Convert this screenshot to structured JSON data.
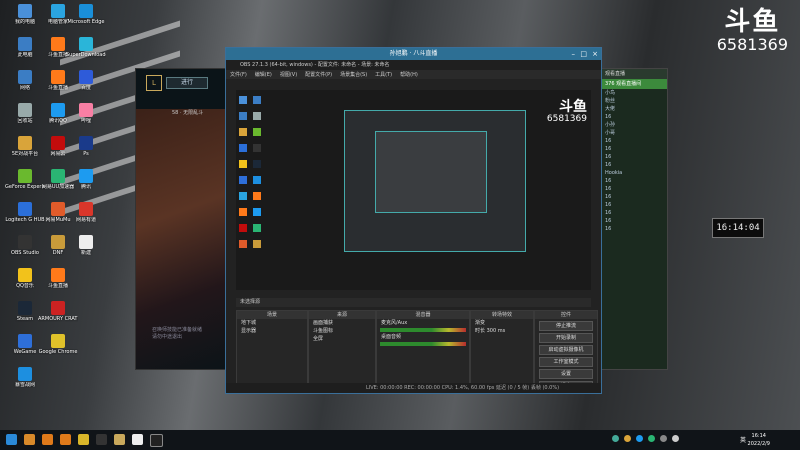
{
  "desktop_icons": [
    {
      "label": "我的电脑",
      "icon": "computer-icon",
      "color": "#4a90d9"
    },
    {
      "label": "此电脑",
      "icon": "computer-icon",
      "color": "#3b7dc4"
    },
    {
      "label": "网络",
      "icon": "network-icon",
      "color": "#3b7dc4"
    },
    {
      "label": "回收站",
      "icon": "recycle-bin-icon",
      "color": "#9aa"
    },
    {
      "label": "5E对战平台",
      "icon": "game-icon",
      "color": "#d9a43a"
    },
    {
      "label": "GeForce Experience",
      "icon": "nvidia-icon",
      "color": "#6ab92e"
    },
    {
      "label": "Logitech G HUB",
      "icon": "logitech-icon",
      "color": "#2b6fd9"
    },
    {
      "label": "OBS Studio",
      "icon": "obs-icon",
      "color": "#333"
    },
    {
      "label": "QQ音乐",
      "icon": "qq-music-icon",
      "color": "#f2c21b"
    },
    {
      "label": "Steam",
      "icon": "steam-icon",
      "color": "#1b2838"
    },
    {
      "label": "WeGame",
      "icon": "wegame-icon",
      "color": "#2e6fd9"
    },
    {
      "label": "暴雪战网",
      "icon": "battlenet-icon",
      "color": "#1d8fe0"
    },
    {
      "label": "电脑管家",
      "icon": "shield-icon",
      "color": "#2aa4e0"
    },
    {
      "label": "斗鱼直播",
      "icon": "douyu-icon",
      "color": "#ff7a1a"
    },
    {
      "label": "斗鱼直播",
      "icon": "douyu-icon",
      "color": "#ff7a1a"
    },
    {
      "label": "腾讯QQ",
      "icon": "qq-icon",
      "color": "#1d9bf0"
    },
    {
      "label": "网易云",
      "icon": "music-icon",
      "color": "#c20c0c"
    },
    {
      "label": "网易UU加速器",
      "icon": "uu-icon",
      "color": "#2ab573"
    },
    {
      "label": "网易MuMu",
      "icon": "game-icon",
      "color": "#e05b2a"
    },
    {
      "label": "DNF",
      "icon": "game-icon",
      "color": "#c99b3a"
    },
    {
      "label": "斗鱼直播",
      "icon": "douyu-icon",
      "color": "#ff7a1a"
    },
    {
      "label": "ARMOURY CRATE",
      "icon": "armoury-icon",
      "color": "#c22"
    },
    {
      "label": "Google Chrome",
      "icon": "chrome-icon",
      "color": "#e0c22a"
    },
    {
      "label": "Microsoft Edge",
      "icon": "edge-icon",
      "color": "#1a8fd9"
    },
    {
      "label": "SuperDownloader",
      "icon": "download-icon",
      "color": "#2ab5d9"
    },
    {
      "label": "百度",
      "icon": "baidu-icon",
      "color": "#2e5bd9"
    },
    {
      "label": "哔哩",
      "icon": "bilibili-icon",
      "color": "#f87fa4"
    },
    {
      "label": "Ps",
      "icon": "photoshop-icon",
      "color": "#1a3a8a"
    },
    {
      "label": "腾讯",
      "icon": "qq-icon",
      "color": "#1d9bf0"
    },
    {
      "label": "网易有道",
      "icon": "dict-icon",
      "color": "#d9362a"
    },
    {
      "label": "新建",
      "icon": "file-icon",
      "color": "#eee"
    }
  ],
  "watermark": {
    "logo": "斗鱼",
    "room": "6581369"
  },
  "clock_widget": "16:14:04",
  "lol": {
    "logo": "L",
    "play": "进行",
    "rank": "58 · 无限乱斗",
    "note1": "召唤师技能已准备就绪",
    "note2": "请勿中途退出"
  },
  "chat": {
    "title": "观看直播",
    "sub": "376 观看直播间",
    "lines": [
      "小鸟",
      "粉丝",
      "大佬",
      "16",
      "小孙",
      "小哥",
      "16",
      "16",
      "16",
      "16",
      "Hookia",
      "16",
      "16",
      "16",
      "16",
      "16",
      "16",
      "16"
    ]
  },
  "obs": {
    "caption": "孙旭鹏 · 八斗直播",
    "title": "OBS 27.1.3 (64-bit, windows) - 配置文件: 未命名 - 场景: 未命名",
    "menu": [
      "文件(F)",
      "编辑(E)",
      "视图(V)",
      "配置文件(P)",
      "场景集合(S)",
      "工具(T)",
      "帮助(H)"
    ],
    "context_bar": "未选择源",
    "preview_wm_logo": "斗鱼",
    "preview_wm_num": "6581369",
    "docks": {
      "scenes": {
        "title": "场景",
        "items": [
          "地下城",
          "显示器"
        ]
      },
      "sources": {
        "title": "来源",
        "items": [
          "画面捕获",
          "斗鱼图标",
          "全屏"
        ]
      },
      "mixer": {
        "title": "混音器",
        "items": [
          "麦克风/Aux",
          "桌面音频"
        ]
      },
      "transitions": {
        "title": "转场特效",
        "items": [
          "渐变",
          "时长 300 ms"
        ]
      },
      "controls": {
        "title": "控件",
        "items": [
          "停止推流",
          "开始录制",
          "启动虚拟摄像机",
          "工作室模式",
          "设置",
          "退出"
        ]
      }
    },
    "status": "LIVE: 00:00:00   REC: 00:00:00   CPU: 1.4%, 60.00 fps   延迟 (0 / 5 帧) 丢帧 (0.0%)"
  },
  "taskbar": {
    "time": "16:14",
    "date": "2022/2/9",
    "lang": "英"
  }
}
